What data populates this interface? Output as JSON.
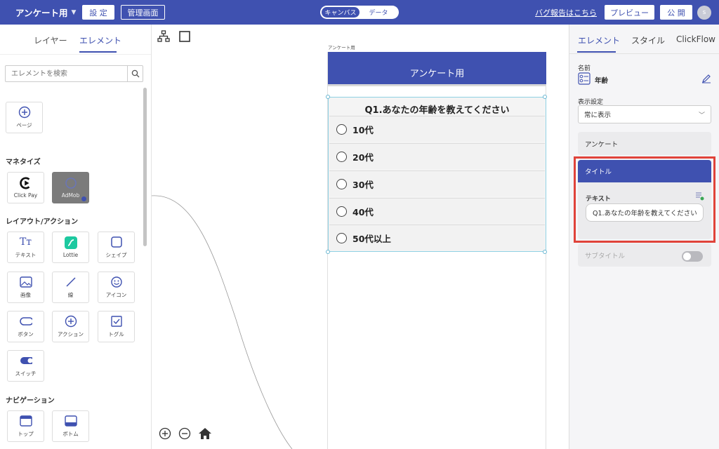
{
  "topbar": {
    "project_name": "アンケート用",
    "settings_label": "設 定",
    "admin_label": "管理画面",
    "mode_canvas": "キャンバス",
    "mode_data": "データ",
    "bug_report": "バグ報告はこちら",
    "preview_label": "プレビュー",
    "publish_label": "公 開",
    "avatar_initial": "s"
  },
  "left": {
    "tab_layer": "レイヤー",
    "tab_element": "エレメント",
    "search_placeholder": "エレメントを検索",
    "page_tile": "ページ",
    "sec_monetize": "マネタイズ",
    "clickpay": "Click Pay",
    "admob": "AdMob",
    "sec_layout": "レイアウト/アクション",
    "items": [
      "テキスト",
      "Lottie",
      "シェイプ",
      "画像",
      "線",
      "アイコン",
      "ボタン",
      "アクション",
      "トグル",
      "スイッチ"
    ],
    "sec_nav": "ナビゲーション",
    "nav_items": [
      "トップ",
      "ボトム"
    ]
  },
  "canvas": {
    "phone_label": "アンケート用",
    "header_title": "アンケート用",
    "question": "Q1.あなたの年齢を教えてください",
    "options": [
      "10代",
      "20代",
      "30代",
      "40代",
      "50代以上"
    ]
  },
  "right": {
    "tab_element": "エレメント",
    "tab_style": "スタイル",
    "tab_clickflow": "ClickFlow",
    "name_label": "名前",
    "name_value": "年齢",
    "display_label": "表示設定",
    "display_value": "常に表示",
    "survey_label": "アンケート",
    "title_label": "タイトル",
    "text_label": "テキスト",
    "text_value": "Q1.あなたの年齢を教えてください",
    "subtitle_label": "サブタイトル"
  },
  "colors": {
    "brand": "#3f51b0",
    "highlight": "#e0433a",
    "lottie": "#1dc9a0"
  }
}
